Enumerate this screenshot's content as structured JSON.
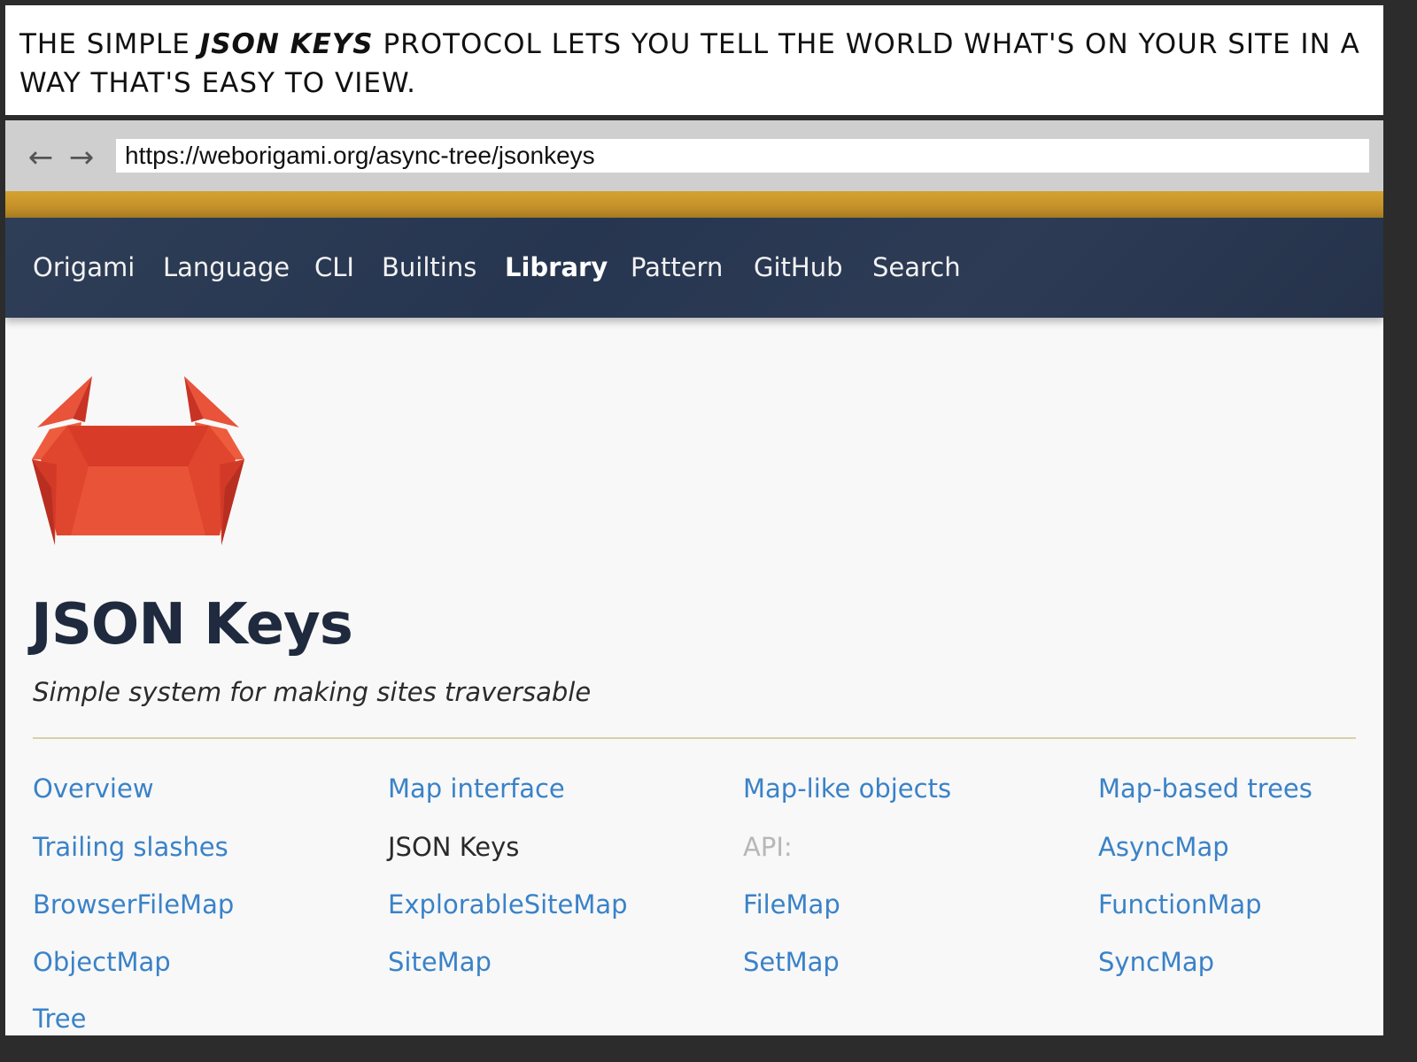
{
  "caption": {
    "before": "The simple ",
    "emphasis": "JSON Keys",
    "after": " protocol lets you tell the world what's on your site in a way that's easy to view."
  },
  "browser": {
    "back_icon": "arrow-left-icon",
    "forward_icon": "arrow-right-icon",
    "url": "https://weborigami.org/async-tree/jsonkeys"
  },
  "site_nav": {
    "items": [
      {
        "label": "Origami",
        "active": false
      },
      {
        "label": "Language",
        "active": false
      },
      {
        "label": "CLI",
        "active": false
      },
      {
        "label": "Builtins",
        "active": false
      },
      {
        "label": "Library",
        "active": true
      },
      {
        "label": "Pattern",
        "active": false
      },
      {
        "label": "GitHub",
        "active": false
      },
      {
        "label": "Search",
        "active": false
      }
    ]
  },
  "page": {
    "logo_icon": "origami-crab-logo",
    "title": "JSON Keys",
    "subtitle": "Simple system for making sites traversable"
  },
  "links": [
    {
      "label": "Overview",
      "kind": "link"
    },
    {
      "label": "Map interface",
      "kind": "link"
    },
    {
      "label": "Map-like objects",
      "kind": "link"
    },
    {
      "label": "Map-based trees",
      "kind": "link"
    },
    {
      "label": "Trailing slashes",
      "kind": "link"
    },
    {
      "label": "JSON Keys",
      "kind": "current"
    },
    {
      "label": "API:",
      "kind": "heading"
    },
    {
      "label": "AsyncMap",
      "kind": "link"
    },
    {
      "label": "BrowserFileMap",
      "kind": "link"
    },
    {
      "label": "ExplorableSiteMap",
      "kind": "link"
    },
    {
      "label": "FileMap",
      "kind": "link"
    },
    {
      "label": "FunctionMap",
      "kind": "link"
    },
    {
      "label": "ObjectMap",
      "kind": "link"
    },
    {
      "label": "SiteMap",
      "kind": "link"
    },
    {
      "label": "SetMap",
      "kind": "link"
    },
    {
      "label": "SyncMap",
      "kind": "link"
    },
    {
      "label": "Tree",
      "kind": "link"
    }
  ],
  "colors": {
    "link": "#3a82c8",
    "nav_background": "#2b3a55",
    "gold_band": "#c6922a",
    "title": "#1f2a3e",
    "logo_red": "#e0452e"
  }
}
